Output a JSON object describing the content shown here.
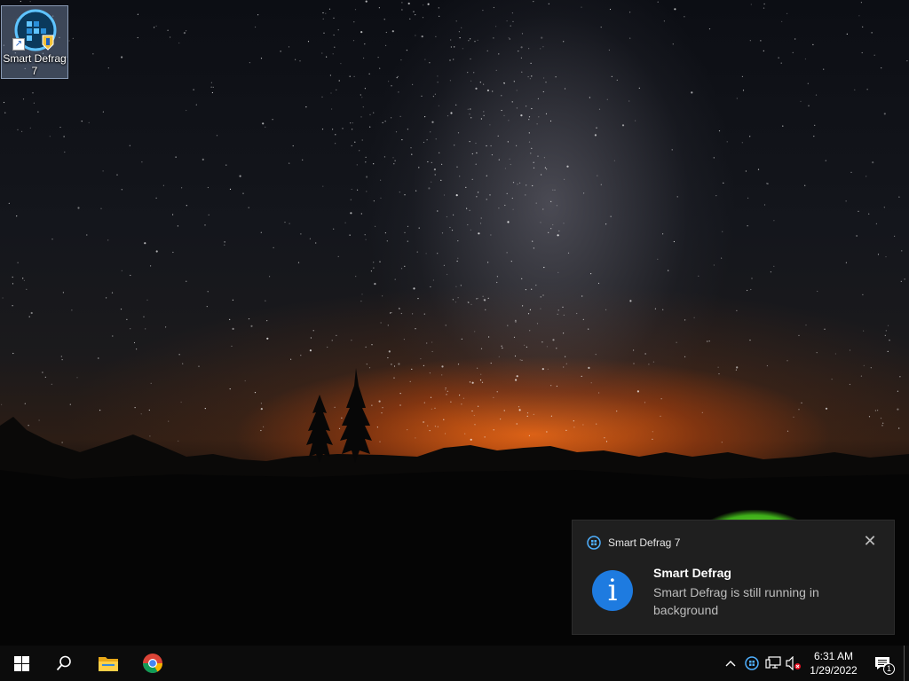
{
  "desktop": {
    "icons": [
      {
        "label": "Smart Defrag 7",
        "icon": "smart-defrag-icon"
      }
    ]
  },
  "notification": {
    "app_name": "Smart Defrag 7",
    "app_icon": "smart-defrag-small-icon",
    "close_icon": "close-icon",
    "info_glyph": "i",
    "title": "Smart Defrag",
    "message": "Smart Defrag is still running in background"
  },
  "taskbar": {
    "start_icon": "windows-logo-icon",
    "search_icon": "search-icon",
    "pinned": [
      {
        "icon": "file-explorer-icon"
      },
      {
        "icon": "chrome-icon"
      }
    ],
    "tray": {
      "chevron_icon": "chevron-up-icon",
      "app_icon": "smart-defrag-tray-icon",
      "network_icon": "network-icon",
      "volume_icon": "volume-muted-icon",
      "time": "6:31 AM",
      "date": "1/29/2022",
      "action_center_icon": "action-center-icon",
      "action_center_badge": "1"
    }
  },
  "colors": {
    "accent": "#1e7be0",
    "toast_bg": "#1f1f1f",
    "taskbar_bg": "#0c0c0c",
    "sunset": "#ff6e14"
  }
}
